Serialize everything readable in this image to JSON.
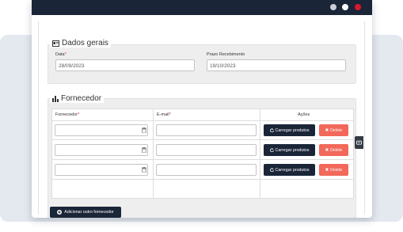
{
  "window": {
    "controls": [
      "minimize",
      "maximize",
      "close"
    ]
  },
  "dados_gerais": {
    "title": "Dados gerais",
    "icon": "id-card-icon",
    "data_label": "Data",
    "data_required": "*",
    "data_value": "28/09/2023",
    "prazo_label": "Prazo Recebimento",
    "prazo_value": "19/10/2023"
  },
  "fornecedor": {
    "title": "Fornecedor",
    "icon": "bar-chart-icon",
    "columns": {
      "fornecedor": "Fornecedor",
      "fornecedor_required": "*",
      "email": "E-mail",
      "email_required": "*",
      "acoes": "Ações"
    },
    "rows": [
      {
        "fornecedor": "",
        "email": "",
        "carregar": "Carregar produtos",
        "delete": "Delete"
      },
      {
        "fornecedor": "",
        "email": "",
        "carregar": "Carregar produtos",
        "delete": "Delete"
      },
      {
        "fornecedor": "",
        "email": "",
        "carregar": "Carregar produtos",
        "delete": "Delete"
      }
    ],
    "add_button": "Adicionar outro fornecedor"
  },
  "colors": {
    "primary": "#1a2538",
    "danger": "#f2685a",
    "close_dot": "#d9182e",
    "panel": "#eeeeee"
  }
}
